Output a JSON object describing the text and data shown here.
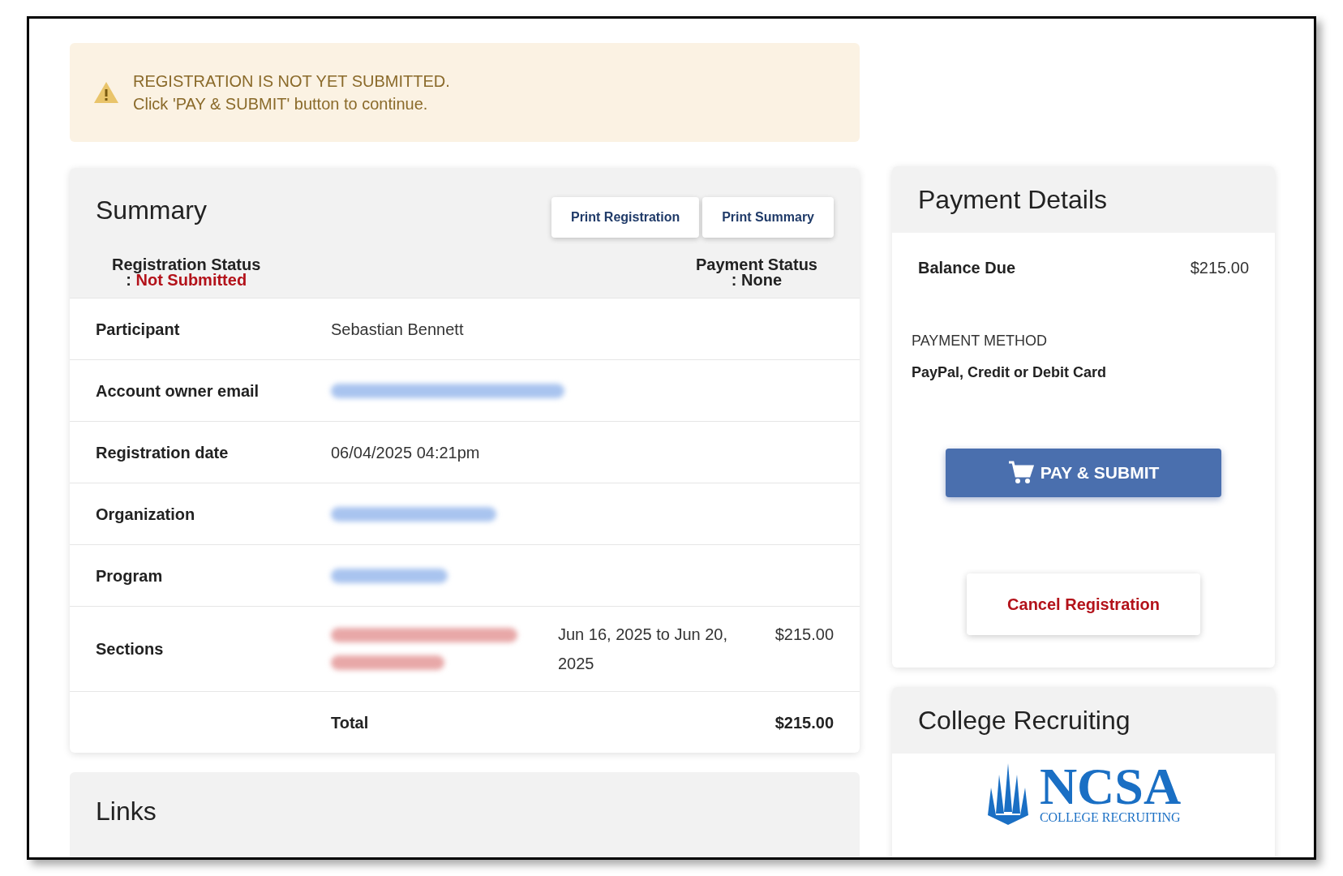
{
  "alert": {
    "title": "REGISTRATION IS NOT YET SUBMITTED.",
    "message": "Click 'PAY & SUBMIT' button to continue."
  },
  "summary": {
    "title": "Summary",
    "buttons": [
      "Print Registration",
      "Print Summary"
    ],
    "registration_status": {
      "label": "Registration Status",
      "separator": ":",
      "value": "Not Submitted"
    },
    "payment_status": {
      "label": "Payment Status",
      "separator": ":",
      "value": "None"
    },
    "rows": [
      {
        "kind": "text",
        "label": "Participant",
        "value": "Sebastian Bennett"
      },
      {
        "kind": "redacted",
        "label": "Account owner email"
      },
      {
        "kind": "text",
        "label": "Registration date",
        "value": "06/04/2025 04:21pm"
      },
      {
        "kind": "redacted",
        "label": "Organization"
      },
      {
        "kind": "redacted",
        "label": "Program"
      },
      {
        "kind": "section",
        "label": "Sections",
        "dates": "Jun 16, 2025 to Jun 20, 2025",
        "price": "$215.00"
      }
    ],
    "total": {
      "label": "Total",
      "value": "$215.00"
    }
  },
  "links": {
    "title": "Links"
  },
  "payment": {
    "title": "Payment Details",
    "balance_label": "Balance Due",
    "balance": "$215.00",
    "method_label": "PAYMENT METHOD",
    "method": "PayPal, Credit or Debit Card",
    "pay_button": "PAY & SUBMIT",
    "cancel_button": "Cancel Registration"
  },
  "recruiting": {
    "title": "College Recruiting",
    "logo_name": "NCSA",
    "logo_tagline": "COLLEGE RECRUITING"
  }
}
